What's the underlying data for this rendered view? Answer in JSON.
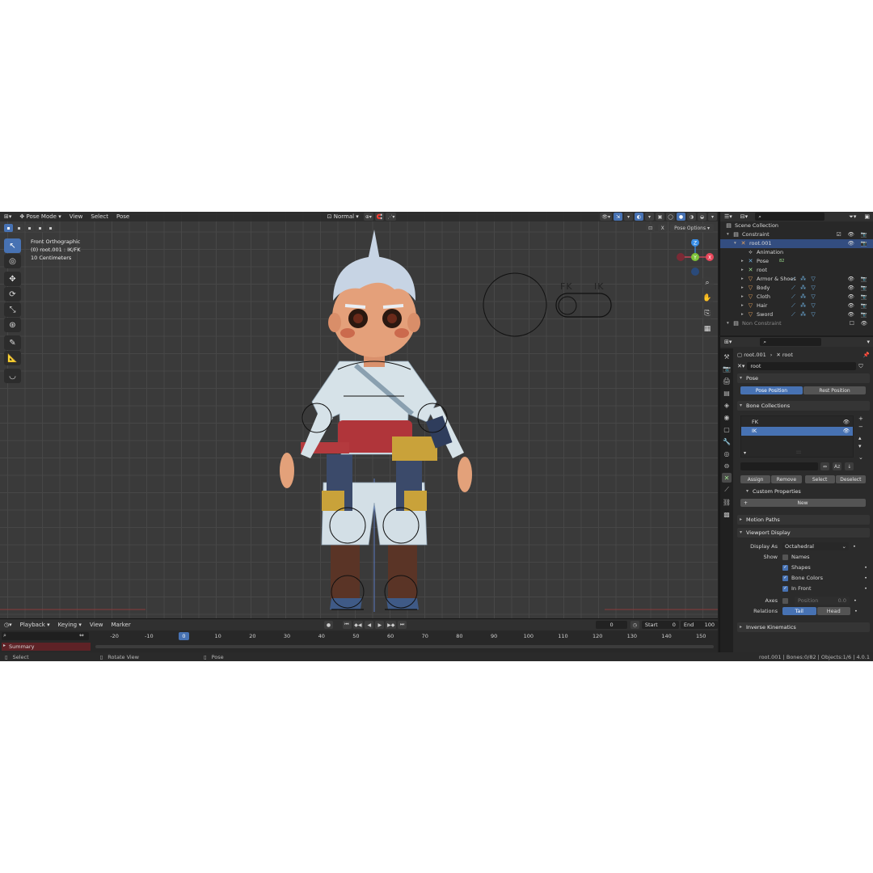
{
  "viewport": {
    "header": {
      "mode": "Pose Mode",
      "menus": [
        "View",
        "Select",
        "Pose"
      ],
      "orientation": "Normal"
    },
    "overlay": {
      "view_name": "Front Orthographic",
      "object_info": "(0) root.001 : IK/FK",
      "scale": "10 Centimeters"
    },
    "pose_options": "Pose Options",
    "rig_labels": {
      "fk": "FK",
      "ik": "IK"
    },
    "axes": {
      "x": "X",
      "y": "Y",
      "z": "Z"
    }
  },
  "timeline": {
    "menus": [
      "Playback",
      "Keying",
      "View",
      "Marker"
    ],
    "current_frame": "0",
    "start_label": "Start",
    "start": "0",
    "end_label": "End",
    "end": "100",
    "ruler_ticks": [
      "-20",
      "-10",
      "0",
      "10",
      "20",
      "30",
      "40",
      "50",
      "60",
      "70",
      "80",
      "90",
      "100",
      "110",
      "120",
      "130",
      "140",
      "150"
    ],
    "summary": "Summary"
  },
  "statusbar": {
    "select": "Select",
    "rotate_view": "Rotate View",
    "pose": "Pose",
    "info": "root.001 | Bones:0/82 | Objects:1/6 | 4.0.1"
  },
  "outliner": {
    "rows": [
      {
        "label": "Scene Collection",
        "level": 0,
        "icon": "collection-icon"
      },
      {
        "label": "Constraint",
        "level": 1,
        "icon": "collection-icon"
      },
      {
        "label": "root.001",
        "level": 2,
        "icon": "armature-icon",
        "selected": true
      },
      {
        "label": "Animation",
        "level": 3,
        "icon": "action-icon"
      },
      {
        "label": "Pose",
        "level": 3,
        "icon": "pose-icon",
        "badge": "82"
      },
      {
        "label": "root",
        "level": 3,
        "icon": "armature-data-icon"
      },
      {
        "label": "Armor & Shoes",
        "level": 3,
        "icon": "mesh-icon"
      },
      {
        "label": "Body",
        "level": 3,
        "icon": "mesh-icon"
      },
      {
        "label": "Cloth",
        "level": 3,
        "icon": "mesh-icon"
      },
      {
        "label": "Hair",
        "level": 3,
        "icon": "mesh-icon"
      },
      {
        "label": "Sword",
        "level": 3,
        "icon": "mesh-icon"
      },
      {
        "label": "Non Constraint",
        "level": 1,
        "icon": "collection-icon",
        "dim": true
      }
    ]
  },
  "properties": {
    "breadcrumb": {
      "object": "root.001",
      "data": "root"
    },
    "data_name": "root",
    "pose_panel": {
      "title": "Pose",
      "pose_position": "Pose Position",
      "rest_position": "Rest Position"
    },
    "bone_collections": {
      "title": "Bone Collections",
      "items": [
        {
          "label": "FK",
          "selected": false
        },
        {
          "label": "IK",
          "selected": true
        }
      ],
      "buttons": [
        "Assign",
        "Remove",
        "Select",
        "Deselect"
      ]
    },
    "custom_properties": {
      "title": "Custom Properties",
      "new": "New"
    },
    "motion_paths": {
      "title": "Motion Paths"
    },
    "viewport_display": {
      "title": "Viewport Display",
      "display_as_label": "Display As",
      "display_as": "Octahedral",
      "show_label": "Show",
      "options": [
        {
          "label": "Names",
          "checked": false
        },
        {
          "label": "Shapes",
          "checked": true
        },
        {
          "label": "Bone Colors",
          "checked": true
        },
        {
          "label": "In Front",
          "checked": true
        }
      ],
      "axes_label": "Axes",
      "position_label": "Position",
      "position_value": "0.0",
      "relations_label": "Relations",
      "relations": [
        "Tail",
        "Head"
      ]
    },
    "inverse_kinematics": {
      "title": "Inverse Kinematics"
    }
  },
  "colors": {
    "accent": "#4772b3",
    "x_axis": "#e8475b",
    "y_axis": "#7ec23a",
    "z_axis": "#3a8fe8"
  }
}
